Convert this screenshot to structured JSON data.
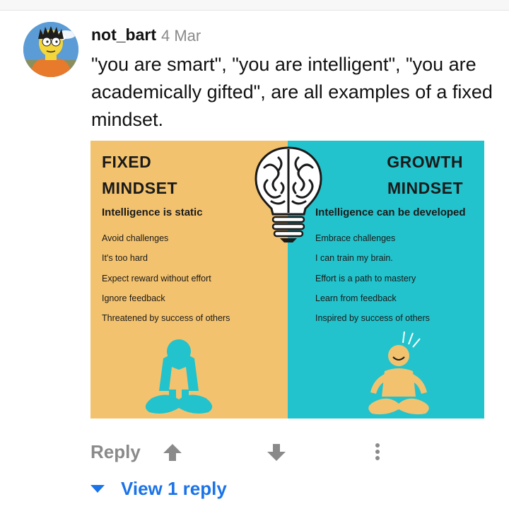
{
  "comment": {
    "author": "not_bart",
    "date": "4 Mar",
    "text": "\"you are smart\", \"you are intelligent\", \"you are academically gifted\", are all examples of a fixed mindset."
  },
  "image": {
    "fixed": {
      "title_line1": "FIXED",
      "title_line2": "MINDSET",
      "subtitle": "Intelligence is static",
      "items": [
        "Avoid challenges",
        "It's too hard",
        "Expect reward without effort",
        "Ignore feedback",
        "Threatened by success of others"
      ],
      "color": "#f3c26e"
    },
    "growth": {
      "title_line1": "GROWTH",
      "title_line2": "MINDSET",
      "subtitle": "Intelligence can be developed",
      "items": [
        "Embrace challenges",
        "I can train my brain.",
        "Effort is a path to mastery",
        "Learn from feedback",
        "Inspired by success of others"
      ],
      "color": "#22c3cc"
    }
  },
  "actions": {
    "reply_label": "Reply",
    "upvote_icon": "arrow-up-icon",
    "downvote_icon": "arrow-down-icon",
    "more_icon": "more-vertical-icon",
    "view_replies_label": "View 1 reply",
    "accent_color": "#1a73e8"
  }
}
